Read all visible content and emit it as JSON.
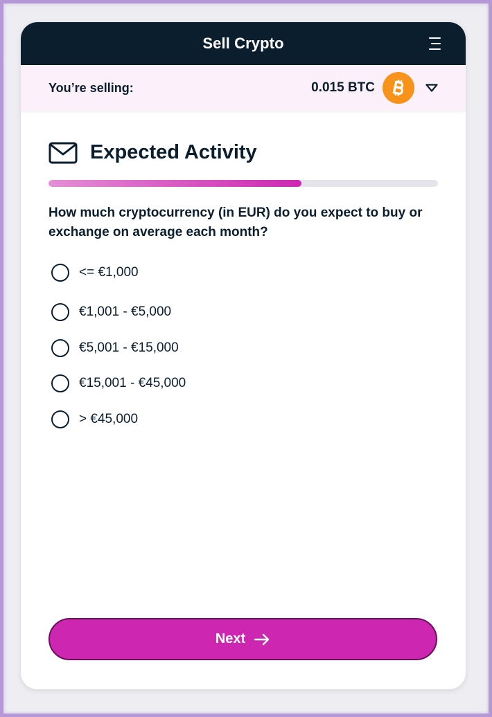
{
  "header": {
    "title": "Sell Crypto",
    "menu_icon": "hamburger-menu-icon"
  },
  "selling": {
    "label": "You’re selling:",
    "amount": "0.015 BTC",
    "coin_icon": "bitcoin-icon",
    "dropdown_icon": "chevron-down-icon"
  },
  "section": {
    "icon": "envelope-icon",
    "title": "Expected Activity"
  },
  "progress": {
    "fraction": 0.65
  },
  "question": "How much cryptocurrency (in EUR) do you expect to buy or exchange on average each month?",
  "options": [
    {
      "label": "<= €1,000",
      "selected": false
    },
    {
      "label": "€1,001 - €5,000",
      "selected": false
    },
    {
      "label": "€5,001 - €15,000",
      "selected": false
    },
    {
      "label": "€15,001 - €45,000",
      "selected": false
    },
    {
      "label": "> €45,000",
      "selected": false
    }
  ],
  "next_button": {
    "label": "Next",
    "icon": "arrow-right-icon"
  },
  "colors": {
    "header_bg": "#0b1e2e",
    "accent": "#cd27b2",
    "selling_bar_bg": "#fcf0fa",
    "bitcoin": "#f7931a"
  }
}
